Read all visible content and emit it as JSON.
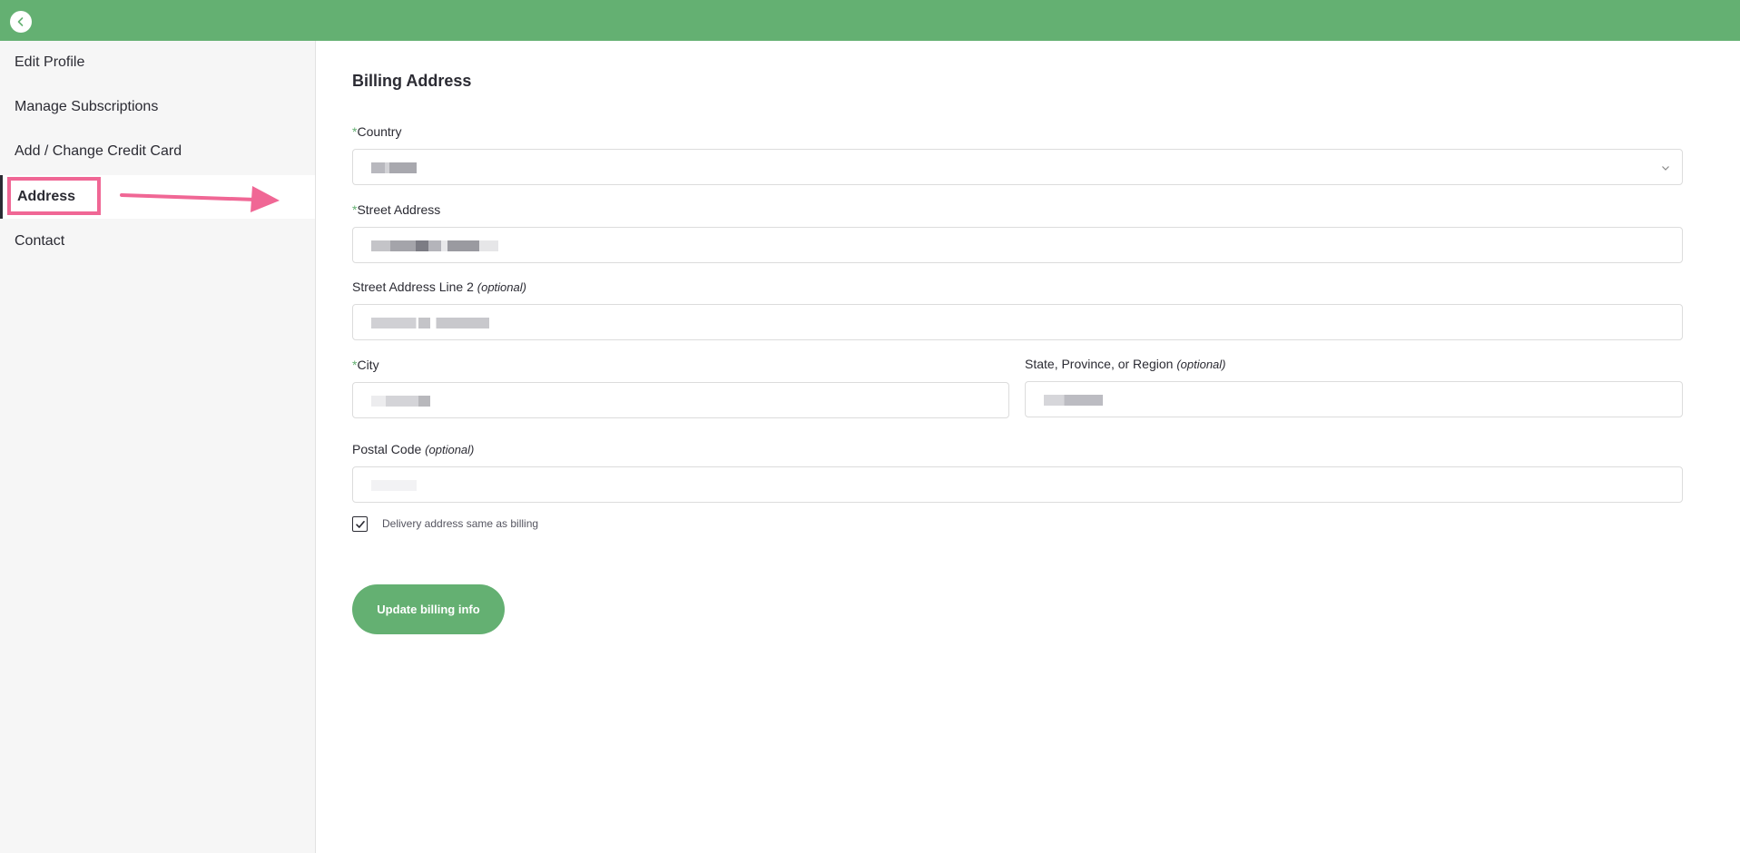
{
  "header": {
    "back_icon": "chevron-left-icon",
    "color": "#64b072"
  },
  "sidebar": {
    "items": [
      {
        "label": "Edit Profile",
        "active": false
      },
      {
        "label": "Manage Subscriptions",
        "active": false
      },
      {
        "label": "Add / Change Credit Card",
        "active": false
      },
      {
        "label": "Address",
        "active": true
      },
      {
        "label": "Contact",
        "active": false
      }
    ]
  },
  "annotation": {
    "highlight_color": "#f06795",
    "arrow_icon": "arrow-right-icon"
  },
  "form": {
    "title": "Billing Address",
    "required_marker": "*",
    "optional_suffix": "(optional)",
    "country": {
      "label": "Country",
      "value": "",
      "redacted": true,
      "chevron_icon": "chevron-down-icon"
    },
    "street": {
      "label": "Street Address",
      "value": "",
      "redacted": true
    },
    "street2": {
      "label": "Street Address Line 2",
      "value": "",
      "redacted": true
    },
    "city": {
      "label": "City",
      "value": "",
      "redacted": true
    },
    "state": {
      "label": "State, Province, or Region",
      "value": "",
      "redacted": true
    },
    "postal": {
      "label": "Postal Code",
      "value": "",
      "redacted": true
    },
    "delivery_same": {
      "label": "Delivery address same as billing",
      "checked": true
    },
    "submit_label": "Update billing info"
  }
}
